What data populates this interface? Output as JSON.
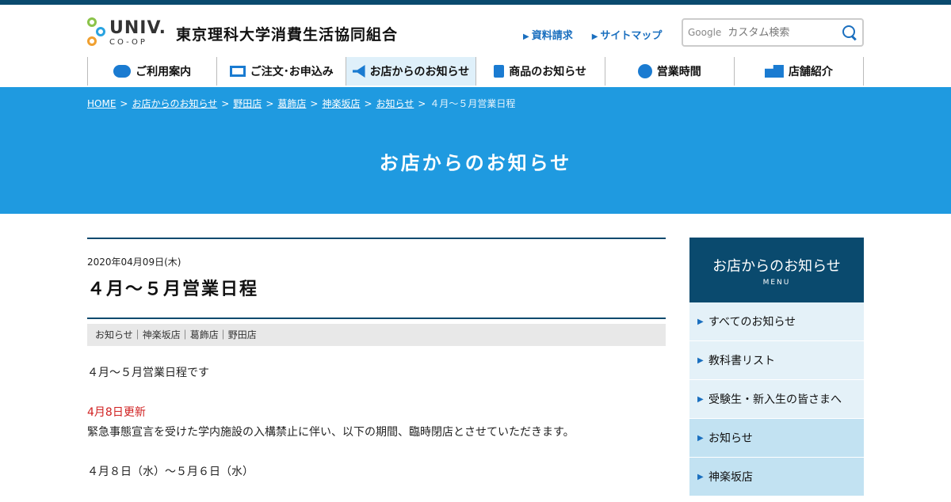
{
  "header": {
    "logo_univ": "UNIV.",
    "logo_coop": "CO-OP",
    "org_name": "東京理科大学消費生活協同組合",
    "util_links": [
      "資料請求",
      "サイトマップ"
    ],
    "search": {
      "brand": "Google",
      "placeholder": "カスタム検索"
    }
  },
  "nav": [
    {
      "label": "ご利用案内",
      "icon": "chat-bubble-icon"
    },
    {
      "label": "ご注文･お申込み",
      "icon": "monitor-icon"
    },
    {
      "label": "お店からのお知らせ",
      "icon": "megaphone-icon"
    },
    {
      "label": "商品のお知らせ",
      "icon": "shopping-bag-icon"
    },
    {
      "label": "営業時間",
      "icon": "clock-icon"
    },
    {
      "label": "店舗紹介",
      "icon": "store-icon"
    }
  ],
  "breadcrumb": [
    "HOME",
    "お店からのお知らせ",
    "野田店",
    "葛飾店",
    "神楽坂店",
    "お知らせ"
  ],
  "breadcrumb_current": "４月〜５月営業日程",
  "breadcrumb_sep": ">",
  "hero_title": "お店からのお知らせ",
  "post": {
    "date": "2020年04月09日(木)",
    "title": "４月〜５月営業日程",
    "categories": "お知らせ｜神楽坂店｜葛飾店｜野田店",
    "lines": [
      "４月〜５月営業日程です",
      "",
      "4月8日更新",
      "緊急事態宣言を受けた学内施設の入構禁止に伴い、以下の期間、臨時閉店とさせていただきます。",
      "",
      "４月８日（水）〜５月６日（水）",
      ""
    ]
  },
  "sidebar": {
    "title": "お店からのお知らせ",
    "subtitle": "MENU",
    "items": [
      "すべてのお知らせ",
      "教科書リスト",
      "受験生・新入生の皆さまへ",
      "お知らせ",
      "神楽坂店"
    ]
  },
  "colors": {
    "navy": "#0a4a6e",
    "hero_blue": "#1f9ae0",
    "link_blue": "#1a6fbf",
    "update_red": "#d02020"
  }
}
